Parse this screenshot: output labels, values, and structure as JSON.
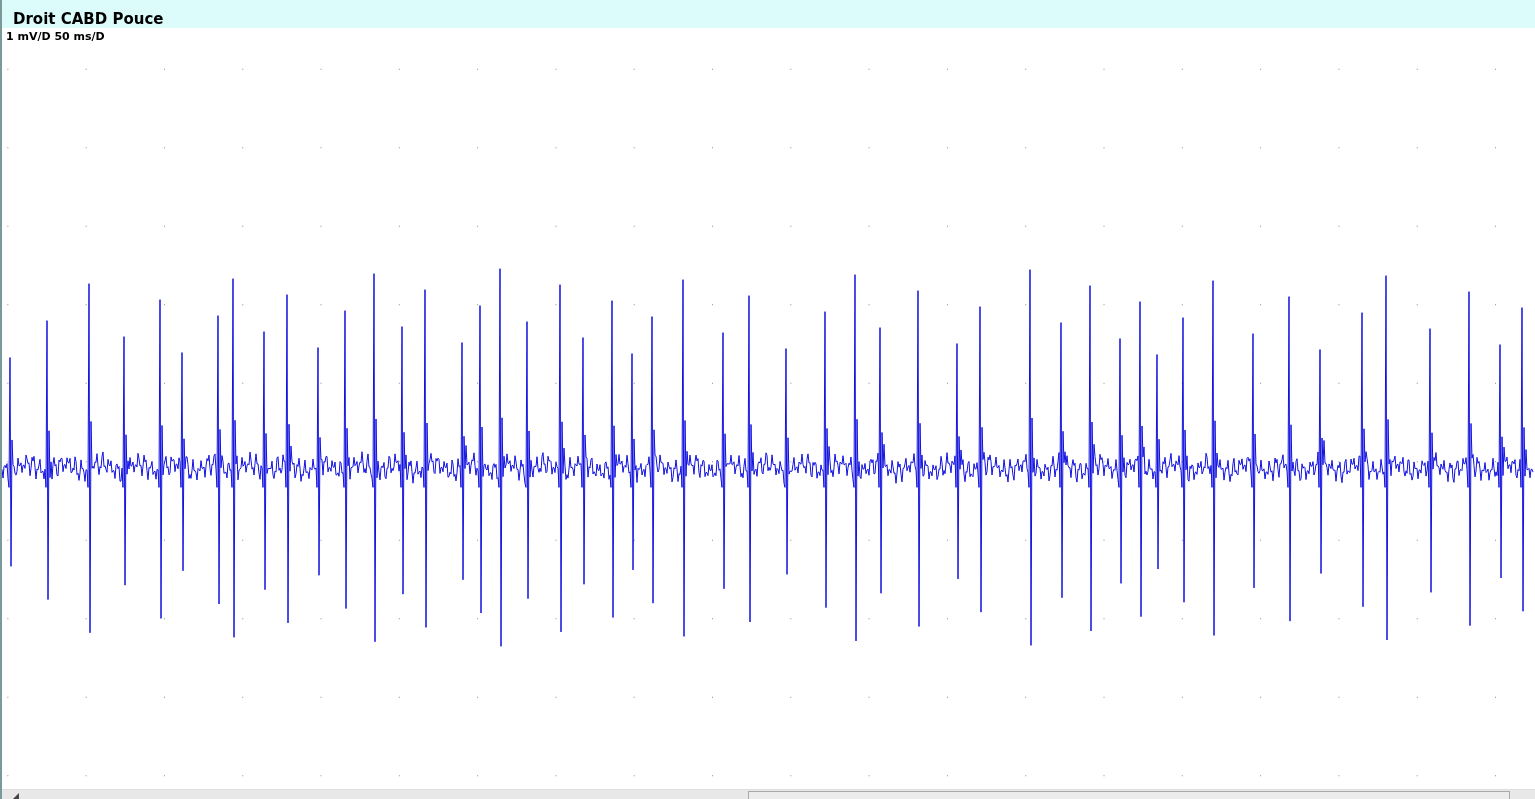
{
  "window": {
    "title": "Droit CABD Pouce"
  },
  "trace": {
    "scale": "1 mV/D 50 ms/D"
  }
}
